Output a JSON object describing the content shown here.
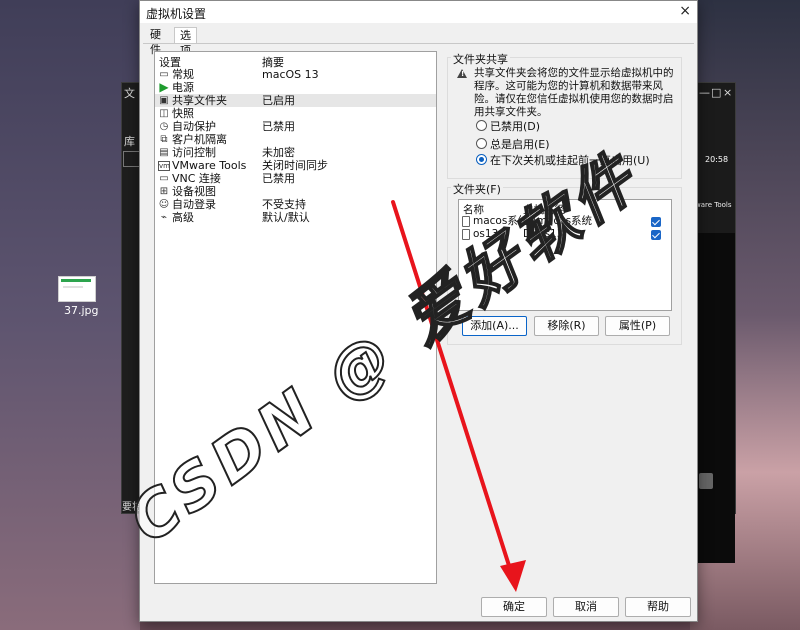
{
  "desktop": {
    "file_label": "37.jpg",
    "bg_left_title": "文",
    "bg_left_label": "库",
    "bg_left_bottom": "要将",
    "bg_right_clock": "20:58",
    "bg_right_tools": "ware Tools",
    "bg_right_min": "—",
    "bg_right_max": "□",
    "bg_right_close": "×"
  },
  "dialog": {
    "title": "虚拟机设置",
    "close": "×",
    "tabs": [
      "硬件",
      "选项"
    ],
    "active_tab": "选项"
  },
  "device_list": {
    "col_setting": "设置",
    "col_summary": "摘要",
    "rows": [
      {
        "name": "常规",
        "value": "macOS 13",
        "icon": "monitor-icon"
      },
      {
        "name": "电源",
        "value": "",
        "icon": "power-play-icon"
      },
      {
        "name": "共享文件夹",
        "value": "已启用",
        "icon": "shared-folder-icon",
        "selected": true
      },
      {
        "name": "快照",
        "value": "",
        "icon": "snapshot-icon"
      },
      {
        "name": "自动保护",
        "value": "已禁用",
        "icon": "clock-icon"
      },
      {
        "name": "客户机隔离",
        "value": "",
        "icon": "isolation-icon"
      },
      {
        "name": "访问控制",
        "value": "未加密",
        "icon": "lock-icon"
      },
      {
        "name": "VMware Tools",
        "value": "关闭时间同步",
        "icon": "vmware-tools-icon"
      },
      {
        "name": "VNC 连接",
        "value": "已禁用",
        "icon": "vnc-icon"
      },
      {
        "name": "设备视图",
        "value": "",
        "icon": "device-view-icon"
      },
      {
        "name": "自动登录",
        "value": "不受支持",
        "icon": "user-icon"
      },
      {
        "name": "高级",
        "value": "默认/默认",
        "icon": "advanced-icon"
      }
    ]
  },
  "share": {
    "group_title": "文件夹共享",
    "info_text": "共享文件夹会将您的文件显示给虚拟机中的程序。这可能为您的计算机和数据带来风险。请仅在您信任虚拟机使用您的数据时启用共享文件夹。",
    "options": [
      "已禁用(D)",
      "总是启用(E)",
      "在下次关机或挂起前一直启用(U)"
    ],
    "selected_index": 2
  },
  "folders": {
    "group_title": "文件夹(F)",
    "col_name": "名称",
    "col_path": "主机路径",
    "rows": [
      {
        "name": "macos系统",
        "path": "E:\\macos系统",
        "checked": true
      },
      {
        "name": "os13",
        "path": "D:\\os13",
        "checked": true
      }
    ],
    "add_label": "添加(A)...",
    "remove_label": "移除(R)",
    "props_label": "属性(P)"
  },
  "footer": {
    "ok_label": "确定",
    "cancel_label": "取消",
    "help_label": "帮助"
  },
  "watermark": {
    "text": "CSDN @ 爱好软件"
  },
  "colors": {
    "accent": "#0a5fbf",
    "arrow": "#e8141c",
    "watermark_stroke": "#222222",
    "watermark_fill": "#ffffff"
  }
}
